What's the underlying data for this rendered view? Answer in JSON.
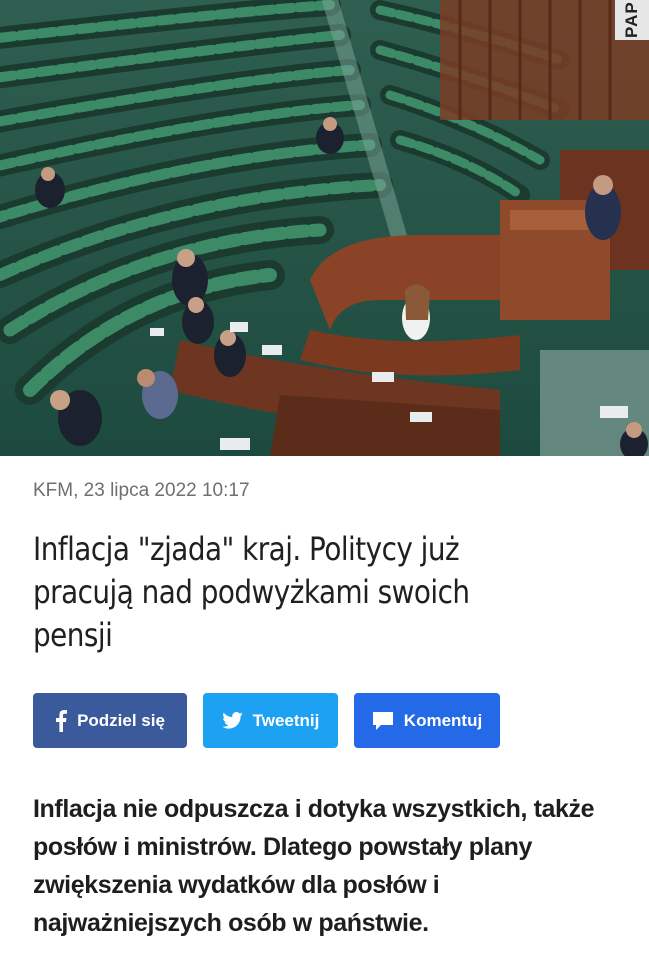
{
  "hero": {
    "image": "Sejm plenary chamber with green seats, few members present",
    "credit_text": "PAP"
  },
  "article": {
    "meta": "KFM, 23 lipca 2022 10:17",
    "headline": "Inflacja \"zjada\" kraj. Politycy już pracują nad podwyżkami swoich pensji",
    "lead": "Inflacja nie odpuszcza i dotyka wszystkich, także posłów i ministrów. Dlatego powstały plany zwiększenia wydatków dla posłów i najważniejszych osób w państwie."
  },
  "share": {
    "facebook_label": "Podziel się",
    "twitter_label": "Tweetnij",
    "comment_label": "Komentuj"
  },
  "colors": {
    "facebook": "#3b5a9b",
    "twitter": "#1da1f2",
    "comment": "#2469e8",
    "meta_text": "#6f6f6f"
  },
  "icons": [
    "facebook-icon",
    "twitter-icon",
    "comment-icon"
  ]
}
